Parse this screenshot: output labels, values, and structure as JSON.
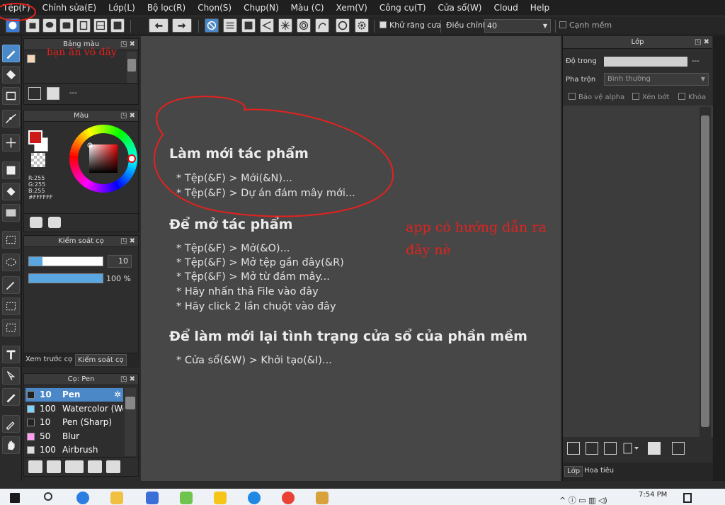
{
  "menu": [
    "Tệp(F)",
    "Chỉnh sửa(E)",
    "Lớp(L)",
    "Bộ lọc(R)",
    "Chọn(S)",
    "Chụp(N)",
    "Màu (C)",
    "Xem(V)",
    "Công cụ(T)",
    "Cửa sổ(W)",
    "Cloud",
    "Help"
  ],
  "toolbar": {
    "antialias_label": "Khử răng cưa",
    "adjust_label": "Điều chỉnh",
    "adjust_value": "40",
    "soft_edge_label": "Cạnh mềm"
  },
  "palette_panel": {
    "title": "Bảng màu",
    "count_text": "---"
  },
  "color_panel": {
    "title": "Màu",
    "r": "R:255",
    "g": "G:255",
    "b": "B:255",
    "hex": "#FFFFFF",
    "fg_color": "#cc1a1a",
    "bg_color": "#ffffff"
  },
  "brush_control": {
    "title": "Kiểm soát cọ",
    "size": "10",
    "opacity": "100 %",
    "size_fraction": 0.18,
    "opacity_fraction": 1.0
  },
  "tabs_mid": [
    "Xem trước cọ",
    "Kiểm soát cọ"
  ],
  "brush_panel": {
    "title": "Cọ: Pen",
    "items": [
      {
        "size": "10",
        "name": "Pen",
        "color": "#222222",
        "selected": true
      },
      {
        "size": "100",
        "name": "Watercolor (We",
        "color": "#7fd4ff",
        "selected": false
      },
      {
        "size": "10",
        "name": "Pen (Sharp)",
        "color": "#222222",
        "selected": false
      },
      {
        "size": "50",
        "name": "Blur",
        "color": "#ff9df0",
        "selected": false
      },
      {
        "size": "100",
        "name": "Airbrush",
        "color": "#dddddd",
        "selected": false
      }
    ]
  },
  "canvas": {
    "sections": [
      {
        "title": "Làm mới tác phẩm",
        "lines": [
          "* Tệp(&F) > Mới(&N)...",
          "* Tệp(&F) > Dự án đám mây mới..."
        ]
      },
      {
        "title": "Để mở tác phẩm",
        "lines": [
          "* Tệp(&F) > Mở(&O)...",
          "* Tệp(&F) > Mở tệp gần đây(&R)",
          "* Tệp(&F) > Mở từ đám mây...",
          "* Hãy nhấn thả File vào đây",
          "* Hãy click 2 lần chuột vào đây"
        ]
      },
      {
        "title": "Để làm mới lại tình trạng cửa sổ của phần mềm",
        "lines": [
          "* Cửa sổ(&W) > Khởi tạo(&I)..."
        ]
      }
    ]
  },
  "layer_panel": {
    "title": "Lớp",
    "opacity_label": "Độ trong",
    "opacity_value": "---",
    "blend_label": "Pha trộn",
    "blend_value": "Bình thường",
    "protect_alpha": "Bảo vệ alpha",
    "clip": "Xén bớt",
    "lock": "Khóa",
    "tabs": [
      "Lớp",
      "Hoa tiêu"
    ]
  },
  "annotations": {
    "top_note": "bạn ấn vô đây",
    "canvas_note_1": "app có hướng dẫn ra",
    "canvas_note_2": "đây nè",
    "color": "#e3221e"
  },
  "taskbar": {
    "time": "7:54 PM"
  }
}
